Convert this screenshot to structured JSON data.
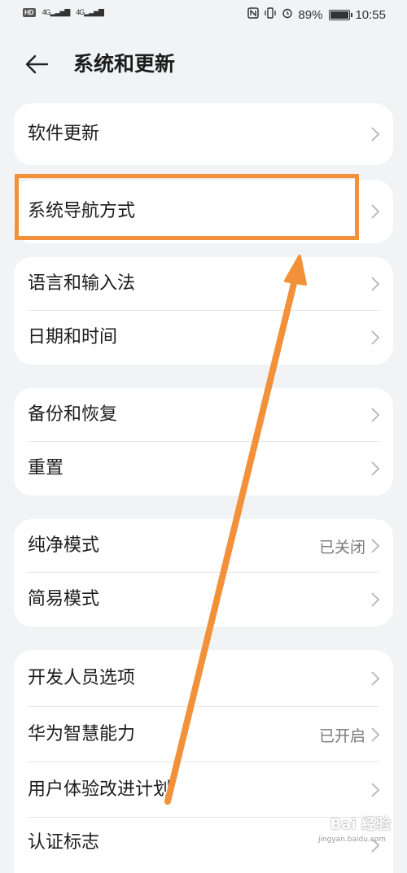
{
  "status_bar": {
    "hd": "HD",
    "sim1": "4G",
    "sim2": "4G",
    "battery_text": "89%",
    "battery_level": 0.89,
    "time": "10:55"
  },
  "header": {
    "title": "系统和更新"
  },
  "groups": [
    {
      "items": [
        {
          "label": "软件更新",
          "value": ""
        }
      ]
    },
    {
      "items": [
        {
          "label": "系统导航方式",
          "value": ""
        }
      ]
    },
    {
      "items": [
        {
          "label": "语言和输入法",
          "value": ""
        },
        {
          "label": "日期和时间",
          "value": ""
        }
      ]
    },
    {
      "items": [
        {
          "label": "备份和恢复",
          "value": ""
        },
        {
          "label": "重置",
          "value": ""
        }
      ]
    },
    {
      "items": [
        {
          "label": "纯净模式",
          "value": "已关闭"
        },
        {
          "label": "简易模式",
          "value": ""
        }
      ]
    },
    {
      "items": [
        {
          "label": "开发人员选项",
          "value": ""
        },
        {
          "label": "华为智慧能力",
          "value": "已开启"
        },
        {
          "label": "用户体验改进计划",
          "value": ""
        },
        {
          "label": "认证标志",
          "value": ""
        }
      ]
    }
  ],
  "watermark": {
    "text": "Bai 经验",
    "sub": "jingyan.baidu.com"
  },
  "colors": {
    "annotation": "#f3913a",
    "background": "#f1f3f5"
  }
}
